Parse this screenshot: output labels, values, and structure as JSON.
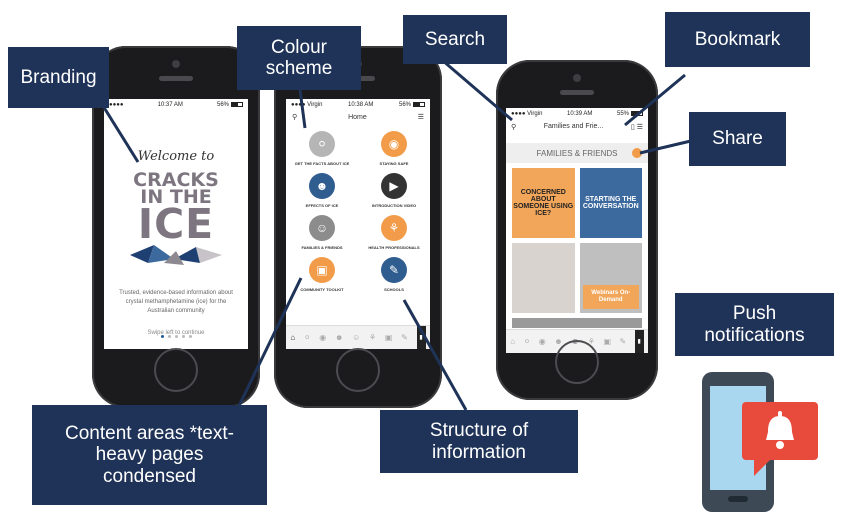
{
  "callouts": {
    "branding": "Branding",
    "colour_scheme": "Colour scheme",
    "search": "Search",
    "bookmark": "Bookmark",
    "share": "Share",
    "content_areas": "Content areas *text-heavy pages condensed",
    "structure": "Structure of information",
    "push": "Push notifications"
  },
  "phone1": {
    "time": "10:37 AM",
    "battery": "56%",
    "welcome": "Welcome to",
    "logo_line1": "CRACKS",
    "logo_line2": "IN THE",
    "logo_line3": "ICE",
    "tagline": "Trusted, evidence-based information about crystal methamphetamine (ice) for the Australian community",
    "swipe": "Swipe left to continue"
  },
  "phone2": {
    "carrier": "Virgin",
    "time": "10:38 AM",
    "battery": "56%",
    "title": "Home",
    "items": [
      {
        "label": "GET THE FACTS ABOUT ICE",
        "color": "#b5b5b5"
      },
      {
        "label": "STAYING SAFE",
        "color": "#f29c4a"
      },
      {
        "label": "EFFECTS OF ICE",
        "color": "#2f5d8f"
      },
      {
        "label": "INTRODUCTION VIDEO",
        "color": "#333333"
      },
      {
        "label": "FAMILIES & FRIENDS",
        "color": "#8c8c8c"
      },
      {
        "label": "HEALTH PROFESSIONALS",
        "color": "#f29c4a"
      },
      {
        "label": "COMMUNITY TOOLKIT",
        "color": "#f29c4a"
      },
      {
        "label": "SCHOOLS",
        "color": "#2f5d8f"
      }
    ]
  },
  "phone3": {
    "carrier": "Virgin",
    "time": "10:39 AM",
    "battery": "55%",
    "title": "Families and Frie...",
    "section": "FAMILIES & FRIENDS",
    "tile1": "CONCERNED ABOUT SOMEONE USING ICE?",
    "tile2": "STARTING THE CONVERSATION",
    "webinar": "Webinars On-Demand"
  },
  "colors": {
    "navy": "#1e3357",
    "orange": "#f29c4a",
    "blue": "#3d6a9e"
  }
}
